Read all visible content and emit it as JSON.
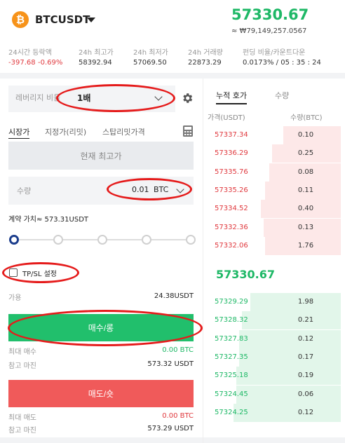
{
  "header": {
    "coin_letter": "₿",
    "symbol": "BTCUSDT",
    "last_price": "57330.67",
    "krw_price": "≈ ₩79,149,257.0567"
  },
  "stats": [
    {
      "label": "24시간 등락액",
      "values": [
        "-397.68",
        "-0.69%"
      ]
    },
    {
      "label": "24h 최고가",
      "values": [
        "58392.94"
      ]
    },
    {
      "label": "24h 최저가",
      "values": [
        "57069.50"
      ]
    },
    {
      "label": "24h 거래량",
      "values": [
        "22873.29"
      ]
    },
    {
      "label": "펀딩 비율/카운트다운",
      "values": [
        "0.0173% / 05 : 35 : 24"
      ]
    }
  ],
  "order_form": {
    "leverage_label": "레버리지 비율",
    "leverage_value": "1배",
    "tabs": [
      "시장가",
      "지정가(리밋)",
      "스탑리밋가격"
    ],
    "best_price_label": "현재 최고가",
    "qty_label": "수량",
    "qty_value": "0.01",
    "qty_unit": "BTC",
    "contract_value_label": "계약 가치≈  573.31USDT",
    "slider_level": 0,
    "tpsl_label": "TP/SL 설정",
    "available_label": "가용",
    "available_value": "24.38USDT",
    "buy_label": "매수/롱",
    "buy_max_label": "최대 매수",
    "buy_max_value": "0.00 BTC",
    "buy_margin_label": "참고 마진",
    "buy_margin_value": "573.32 USDT",
    "sell_label": "매도/숏",
    "sell_max_label": "최대 매도",
    "sell_max_value": "0.00 BTC",
    "sell_margin_label": "참고 마진",
    "sell_margin_value": "573.29 USDT"
  },
  "orderbook": {
    "tabs": [
      "누적 호가",
      "수량"
    ],
    "price_header": "가격(USDT)",
    "qty_header": "수량(BTC)",
    "asks": [
      {
        "price": "57337.34",
        "qty": "0.10",
        "depth": 0.42
      },
      {
        "price": "57336.29",
        "qty": "0.25",
        "depth": 0.5
      },
      {
        "price": "57335.76",
        "qty": "0.08",
        "depth": 0.52
      },
      {
        "price": "57335.26",
        "qty": "0.11",
        "depth": 0.55
      },
      {
        "price": "57334.52",
        "qty": "0.40",
        "depth": 0.58
      },
      {
        "price": "57332.36",
        "qty": "0.13",
        "depth": 0.56
      },
      {
        "price": "57332.06",
        "qty": "1.76",
        "depth": 0.55
      }
    ],
    "mid_price": "57330.67",
    "bids": [
      {
        "price": "57329.29",
        "qty": "1.98",
        "depth": 0.66
      },
      {
        "price": "57328.32",
        "qty": "0.21",
        "depth": 0.72
      },
      {
        "price": "57327.83",
        "qty": "0.12",
        "depth": 0.74
      },
      {
        "price": "57327.35",
        "qty": "0.17",
        "depth": 0.74
      },
      {
        "price": "57325.18",
        "qty": "0.19",
        "depth": 0.76
      },
      {
        "price": "57324.45",
        "qty": "0.06",
        "depth": 0.76
      },
      {
        "price": "57324.25",
        "qty": "0.12",
        "depth": 0.78
      }
    ]
  },
  "colors": {
    "up": "#1eb866",
    "down": "#e0393e",
    "buy": "#21bf6c",
    "sell": "#f05a5a",
    "annotation": "#e51b1b"
  }
}
